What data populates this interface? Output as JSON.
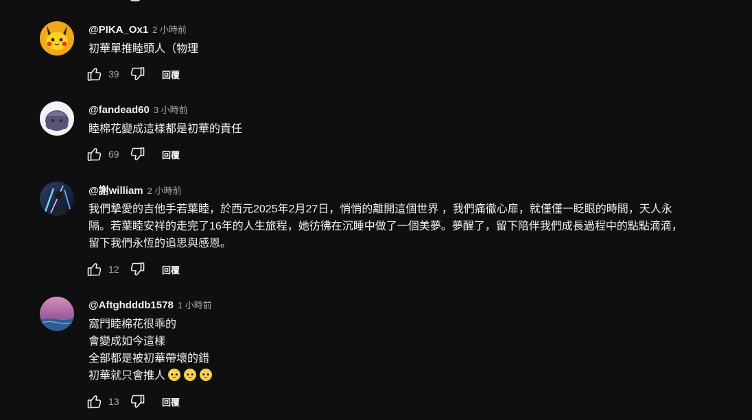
{
  "comments": [
    {
      "handle": "@PIKA_Ox1",
      "time": "2 小時前",
      "lines": [
        "初華單推睦頭人（物理"
      ],
      "likes": "39",
      "avatar": "pikachu"
    },
    {
      "handle": "@fandead60",
      "time": "3 小時前",
      "lines": [
        "睦棉花變成這樣都是初華的責任"
      ],
      "likes": "69",
      "avatar": "purple-ghost"
    },
    {
      "handle": "@謝william",
      "time": "2 小時前",
      "lines": [
        "我們摯愛的吉他手若葉睦，於西元2025年2月27日，悄悄的離開這個世界 ，我們痛徹心扉，就僅僅一眨眼的時間，天人永",
        "隔。若葉睦安祥的走完了16年的人生旅程，她彷彿在沉睡中做了一個美夢。夢醒了，留下陪伴我們成長過程中的點點滴滴，",
        "留下我們永恆的追思與感恩。"
      ],
      "likes": "12",
      "avatar": "anime-swordsman"
    },
    {
      "handle": "@Aftghdddb1578",
      "time": "1 小時前",
      "lines": [
        "窩門睦棉花很乖的",
        "會變成如今這樣",
        "全部都是被初華帶壞的錯",
        "初華就只會推人"
      ],
      "likes": "13",
      "avatar": "pink-sunset",
      "emoji_count": 3
    }
  ],
  "reply_label": "回覆",
  "colors": {
    "background": "#0f0f0f",
    "text": "#f1f1f1",
    "secondary": "#aaaaaa"
  },
  "icons": [
    "thumb-up-icon",
    "thumb-down-icon",
    "pleading-face-emoji"
  ]
}
